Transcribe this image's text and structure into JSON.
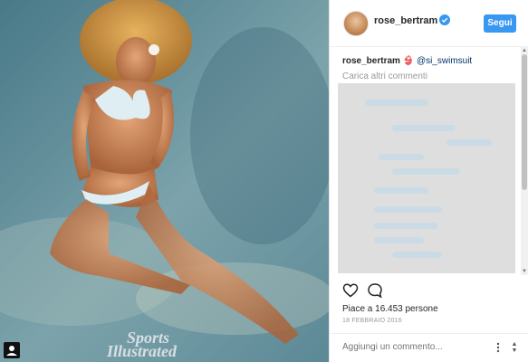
{
  "photo": {
    "alt_text": "",
    "watermark_line1": "Sports",
    "watermark_line2": "Illustrated",
    "badge_icon": "person-tag-icon"
  },
  "header": {
    "username": "rose_bertram",
    "verified_icon": "verified-badge-icon",
    "follow_label": "Segui"
  },
  "caption": {
    "username": "rose_bertram",
    "emoji": "👙",
    "handle": "@si_swimsuit"
  },
  "comments": {
    "load_more_label": "Carica altri commenti"
  },
  "actions": {
    "like_icon": "heart-icon",
    "comment_icon": "comment-icon",
    "likes_text": "Piace a 16.453 persone",
    "date": "18 FEBBRAIO 2016"
  },
  "comment_box": {
    "placeholder": "Aggiungi un commento...",
    "more_icon": "more-options-icon"
  },
  "colors": {
    "accent": "#3897f0",
    "text": "#262626",
    "muted": "#999999"
  }
}
